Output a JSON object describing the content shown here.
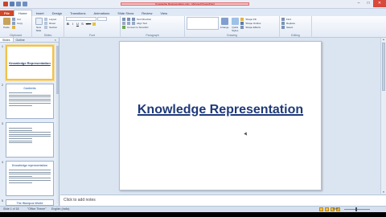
{
  "window": {
    "title": "Knowledge Representation.pptx - Microsoft PowerPoint",
    "min": "–",
    "max": "□",
    "close": "✕"
  },
  "ribbon_tabs": [
    "File",
    "Home",
    "Insert",
    "Design",
    "Transitions",
    "Animations",
    "Slide Show",
    "Review",
    "View"
  ],
  "active_tab": "Home",
  "ribbon": {
    "clipboard": {
      "paste": "Paste",
      "cut": "Cut",
      "copy": "Copy",
      "format_painter": "Format Painter",
      "label": "Clipboard"
    },
    "slides": {
      "new_slide": "New Slide",
      "layout": "Layout",
      "reset": "Reset",
      "section": "Section",
      "label": "Slides"
    },
    "font": {
      "label": "Font",
      "bold": "B",
      "italic": "I",
      "underline": "U",
      "shadow": "S",
      "strike": "abc"
    },
    "paragraph": {
      "label": "Paragraph",
      "text_direction": "Text Direction",
      "align_text": "Align Text",
      "convert_smartart": "Convert to SmartArt"
    },
    "drawing": {
      "label": "Drawing",
      "arrange": "Arrange",
      "quick_styles": "Quick Styles",
      "shape_fill": "Shape Fill",
      "shape_outline": "Shape Outline",
      "shape_effects": "Shape Effects"
    },
    "editing": {
      "label": "Editing",
      "find": "Find",
      "replace": "Replace",
      "select": "Select"
    }
  },
  "left_panel": {
    "tabs": [
      "Slides",
      "Outline"
    ],
    "close": "×",
    "slides": [
      {
        "num": "1",
        "title": "Knowledge Representation",
        "selected": true,
        "kind": "title"
      },
      {
        "num": "2",
        "heading": "Contents",
        "kind": "text"
      },
      {
        "num": "3",
        "heading": "",
        "kind": "text"
      },
      {
        "num": "4",
        "heading": "Knowledge representation",
        "kind": "text"
      },
      {
        "num": "5",
        "heading": "The Wumpus World",
        "kind": "text"
      }
    ]
  },
  "slide": {
    "title": "Knowledge Representation"
  },
  "notes": {
    "placeholder": "Click to add notes"
  },
  "status": {
    "slide_info": "Slide 1 of 18",
    "theme": "\"Office Theme\"",
    "language": "English (India)",
    "zoom": "69%"
  },
  "colors": {
    "file_tab": "#d24726",
    "title_text": "#1f3a7a",
    "selected_thumb_border": "#f2c14a"
  }
}
